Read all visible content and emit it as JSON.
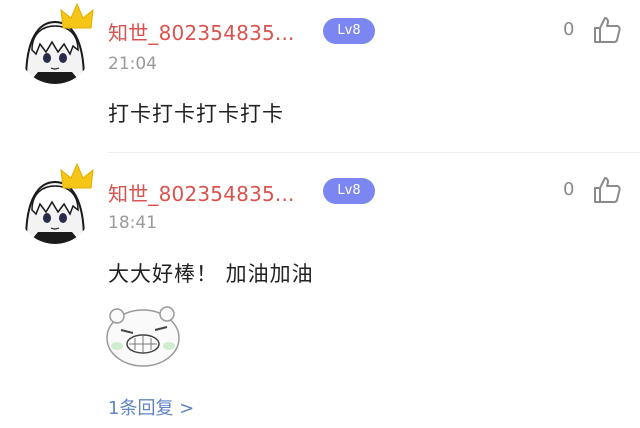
{
  "comments": [
    {
      "username": "知世_802354835...",
      "level": "Lv8",
      "time": "21:04",
      "likes": "0",
      "text": "打卡打卡打卡打卡"
    },
    {
      "username": "知世_802354835...",
      "level": "Lv8",
      "time": "18:41",
      "likes": "0",
      "text": "大大好棒！ 加油加油",
      "replies": "1条回复 >"
    }
  ],
  "colors": {
    "username": "#d9534f",
    "level_badge": "#7b86f0",
    "reply_link": "#5f86c2",
    "crown": "#f5c617"
  }
}
